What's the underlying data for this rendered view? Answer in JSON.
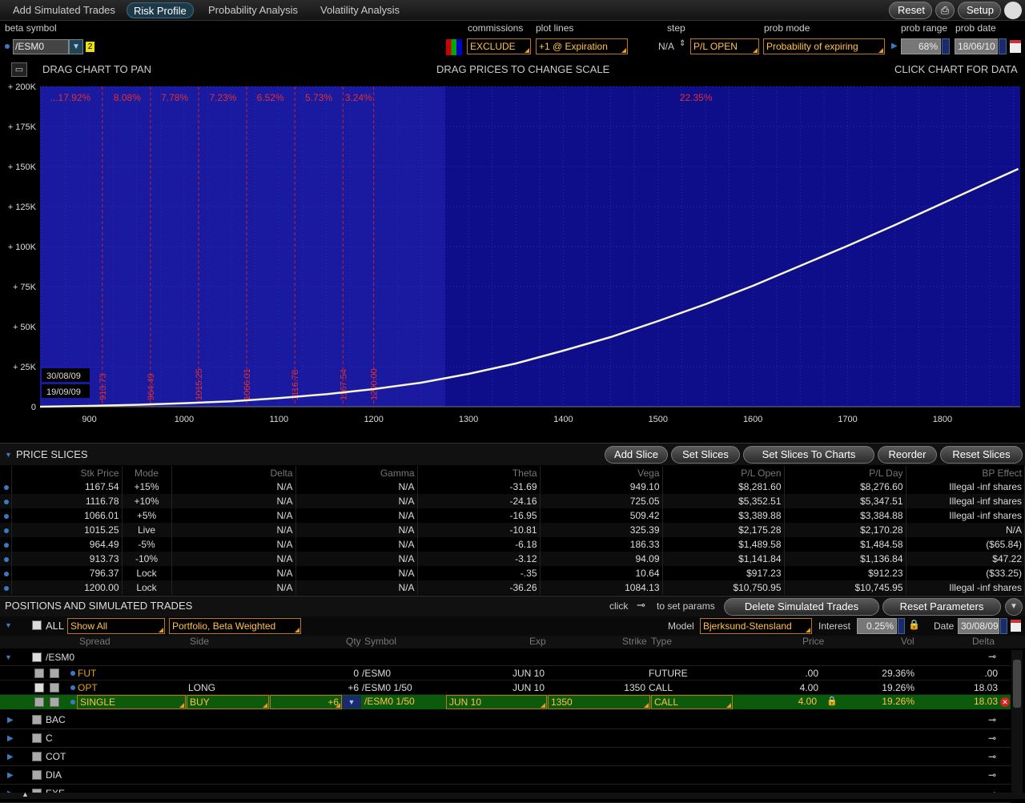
{
  "tabs": [
    {
      "label": "Add Simulated Trades",
      "active": false
    },
    {
      "label": "Risk Profile",
      "active": true
    },
    {
      "label": "Probability Analysis",
      "active": false
    },
    {
      "label": "Volatility Analysis",
      "active": false
    }
  ],
  "header_buttons": {
    "reset": "Reset",
    "setup": "Setup"
  },
  "controls": {
    "beta_symbol_label": "beta symbol",
    "beta_symbol": "/ESM0",
    "beta_badge": "2",
    "commissions_label": "commissions",
    "commissions": "EXCLUDE",
    "plot_lines_label": "plot lines",
    "plot_lines": "+1 @ Expiration",
    "step_label": "step",
    "step": "N/A",
    "pl_mode": "P/L OPEN",
    "prob_mode_label": "prob mode",
    "prob_mode": "Probability of expiring",
    "prob_range_label": "prob range",
    "prob_range": "68%",
    "prob_date_label": "prob date",
    "prob_date": "18/06/10"
  },
  "chart_header": {
    "left": "DRAG CHART TO PAN",
    "center": "DRAG PRICES TO CHANGE SCALE",
    "right": "CLICK CHART FOR DATA"
  },
  "chart_data": {
    "type": "line",
    "x_ticks": [
      "900",
      "1000",
      "1100",
      "1200",
      "1300",
      "1400",
      "1500",
      "1600",
      "1700",
      "1800"
    ],
    "y_ticks": [
      "0",
      "+ 25K",
      "+ 50K",
      "+ 75K",
      "+ 100K",
      "+ 125K",
      "+ 150K",
      "+ 175K",
      "+ 200K"
    ],
    "xlim": [
      848,
      1882
    ],
    "ylim": [
      0,
      200000
    ],
    "slice_prices": [
      913.73,
      964.49,
      1015.25,
      1066.01,
      1116.78,
      1167.54,
      1200.0
    ],
    "slice_labels": [
      "913.73",
      "964.49",
      "1015.25",
      "1066.01",
      "1116.78",
      "1167.54",
      "1200.00"
    ],
    "probabilities": [
      {
        "text": "...17.92%",
        "x": 880
      },
      {
        "text": "8.08%",
        "x": 940
      },
      {
        "text": "7.78%",
        "x": 990
      },
      {
        "text": "7.23%",
        "x": 1041
      },
      {
        "text": "6.52%",
        "x": 1091
      },
      {
        "text": "5.73%",
        "x": 1142
      },
      {
        "text": "3.24%",
        "x": 1184
      },
      {
        "text": "22.35%",
        "x": 1540
      }
    ],
    "prob_range_band": [
      848,
      1275
    ],
    "dates": [
      "30/08/09",
      "19/09/09"
    ],
    "series": [
      {
        "color": "#ffffa0",
        "x": [
          848,
          900,
          950,
          1000,
          1050,
          1100,
          1150,
          1200,
          1250,
          1300,
          1350,
          1400,
          1450,
          1500,
          1550,
          1600,
          1650,
          1700,
          1750,
          1800,
          1850,
          1880
        ],
        "y": [
          0,
          500,
          1200,
          2200,
          3400,
          5400,
          7800,
          11000,
          15000,
          20500,
          27000,
          35000,
          43500,
          53500,
          64000,
          75500,
          88000,
          100500,
          113500,
          127000,
          140500,
          148500
        ]
      }
    ]
  },
  "price_slices": {
    "title": "PRICE SLICES",
    "buttons": [
      "Add Slice",
      "Set Slices",
      "Set Slices To Charts",
      "Reorder",
      "Reset Slices"
    ],
    "columns": [
      "Stk Price",
      "Mode",
      "Delta",
      "Gamma",
      "Theta",
      "Vega",
      "P/L Open",
      "P/L Day",
      "BP Effect"
    ],
    "rows": [
      [
        "1167.54",
        "+15%",
        "N/A",
        "N/A",
        "-31.69",
        "949.10",
        "$8,281.60",
        "$8,276.60",
        "Illegal -inf shares"
      ],
      [
        "1116.78",
        "+10%",
        "N/A",
        "N/A",
        "-24.16",
        "725.05",
        "$5,352.51",
        "$5,347.51",
        "Illegal -inf shares"
      ],
      [
        "1066.01",
        "+5%",
        "N/A",
        "N/A",
        "-16.95",
        "509.42",
        "$3,389.88",
        "$3,384.88",
        "Illegal -inf shares"
      ],
      [
        "1015.25",
        "Live",
        "N/A",
        "N/A",
        "-10.81",
        "325.39",
        "$2,175.28",
        "$2,170.28",
        "N/A"
      ],
      [
        "964.49",
        "-5%",
        "N/A",
        "N/A",
        "-6.18",
        "186.33",
        "$1,489.58",
        "$1,484.58",
        "($65.84)"
      ],
      [
        "913.73",
        "-10%",
        "N/A",
        "N/A",
        "-3.12",
        "94.09",
        "$1,141.84",
        "$1,136.84",
        "$47.22"
      ],
      [
        "796.37",
        "Lock",
        "N/A",
        "N/A",
        "-.35",
        "10.64",
        "$917.23",
        "$912.23",
        "($33.25)"
      ],
      [
        "1200.00",
        "Lock",
        "N/A",
        "N/A",
        "-36.26",
        "1084.13",
        "$10,750.95",
        "$10,745.95",
        "Illegal -inf shares"
      ]
    ]
  },
  "positions": {
    "title": "POSITIONS AND SIMULATED TRADES",
    "click_text": "click",
    "params_text": "to set params",
    "delete_btn": "Delete Simulated Trades",
    "reset_params_btn": "Reset Parameters",
    "all_label": "ALL",
    "show": "Show All",
    "view": "Portfolio, Beta Weighted",
    "model_label": "Model",
    "model": "Bjerksund-Stensland",
    "interest_label": "Interest",
    "interest": "0.25%",
    "date_label": "Date",
    "date": "30/08/09",
    "columns": [
      "Spread",
      "Side",
      "Qty",
      "Symbol",
      "Exp",
      "Strike",
      "Type",
      "Price",
      "Vol",
      "Delta"
    ],
    "group": "/ESM0",
    "rows": [
      {
        "spread": "FUT",
        "side": "",
        "qty": "0",
        "symbol": "/ESM0",
        "exp": "JUN 10",
        "strike": "",
        "type": "FUTURE",
        "price": ".00",
        "vol": "29.36%",
        "delta": ".00",
        "checked": false
      },
      {
        "spread": "OPT",
        "side": "LONG",
        "qty": "+6",
        "symbol": "/ESM0 1/50",
        "exp": "JUN 10",
        "strike": "1350",
        "type": "CALL",
        "price": "4.00",
        "vol": "19.26%",
        "delta": "18.03",
        "checked": true
      }
    ],
    "sim_row": {
      "spread": "SINGLE",
      "side": "BUY",
      "qty": "+6",
      "symbol": "/ESM0 1/50",
      "exp": "JUN 10",
      "strike": "1350",
      "type": "CALL",
      "price": "4.00",
      "vol": "19.26%",
      "delta": "18.03"
    },
    "other_groups": [
      "BAC",
      "C",
      "COT",
      "DIA",
      "EXE"
    ]
  }
}
